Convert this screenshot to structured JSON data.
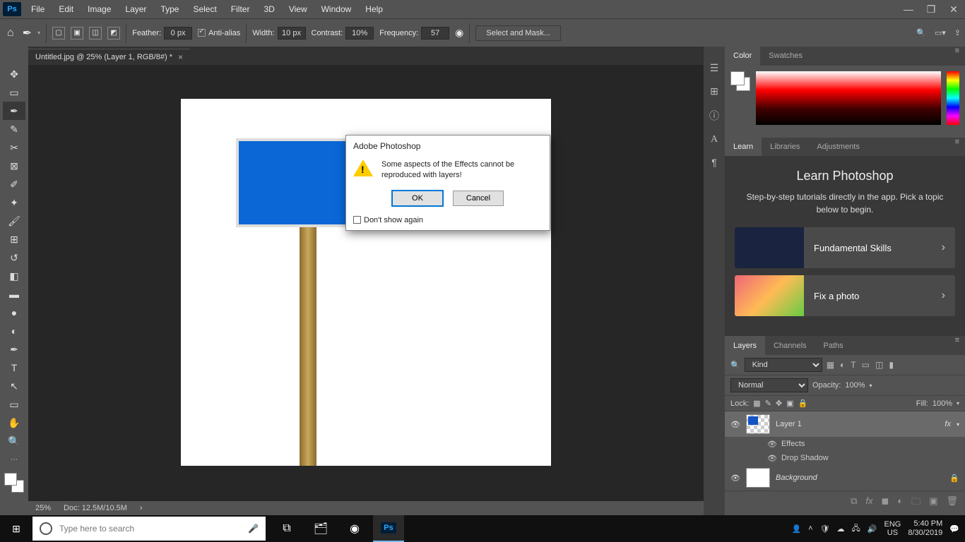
{
  "menu": {
    "items": [
      "File",
      "Edit",
      "Image",
      "Layer",
      "Type",
      "Select",
      "Filter",
      "3D",
      "View",
      "Window",
      "Help"
    ]
  },
  "options": {
    "feather_label": "Feather:",
    "feather_value": "0 px",
    "antialias_label": "Anti-alias",
    "width_label": "Width:",
    "width_value": "10 px",
    "contrast_label": "Contrast:",
    "contrast_value": "10%",
    "frequency_label": "Frequency:",
    "frequency_value": "57",
    "select_mask": "Select and Mask..."
  },
  "document": {
    "tab_title": "Untitled.jpg @ 25% (Layer 1, RGB/8#) *"
  },
  "status": {
    "zoom": "25%",
    "doc": "Doc: 12.5M/10.5M"
  },
  "panels": {
    "color_tabs": [
      "Color",
      "Swatches"
    ],
    "learn_tabs": [
      "Learn",
      "Libraries",
      "Adjustments"
    ],
    "learn": {
      "title": "Learn Photoshop",
      "subtitle": "Step-by-step tutorials directly in the app. Pick a topic below to begin.",
      "cards": [
        "Fundamental Skills",
        "Fix a photo"
      ]
    },
    "layers_tabs": [
      "Layers",
      "Channels",
      "Paths"
    ],
    "layers": {
      "kind": "Kind",
      "blend": "Normal",
      "opacity_label": "Opacity:",
      "opacity_value": "100%",
      "lock_label": "Lock:",
      "fill_label": "Fill:",
      "fill_value": "100%",
      "layer1": "Layer 1",
      "effects": "Effects",
      "dropshadow": "Drop Shadow",
      "background": "Background"
    }
  },
  "dialog": {
    "title": "Adobe Photoshop",
    "message": "Some aspects of the Effects cannot be reproduced with layers!",
    "ok": "OK",
    "cancel": "Cancel",
    "dont_show": "Don't show again"
  },
  "taskbar": {
    "search_placeholder": "Type here to search",
    "lang1": "ENG",
    "lang2": "US",
    "time": "5:40 PM",
    "date": "8/30/2019"
  }
}
